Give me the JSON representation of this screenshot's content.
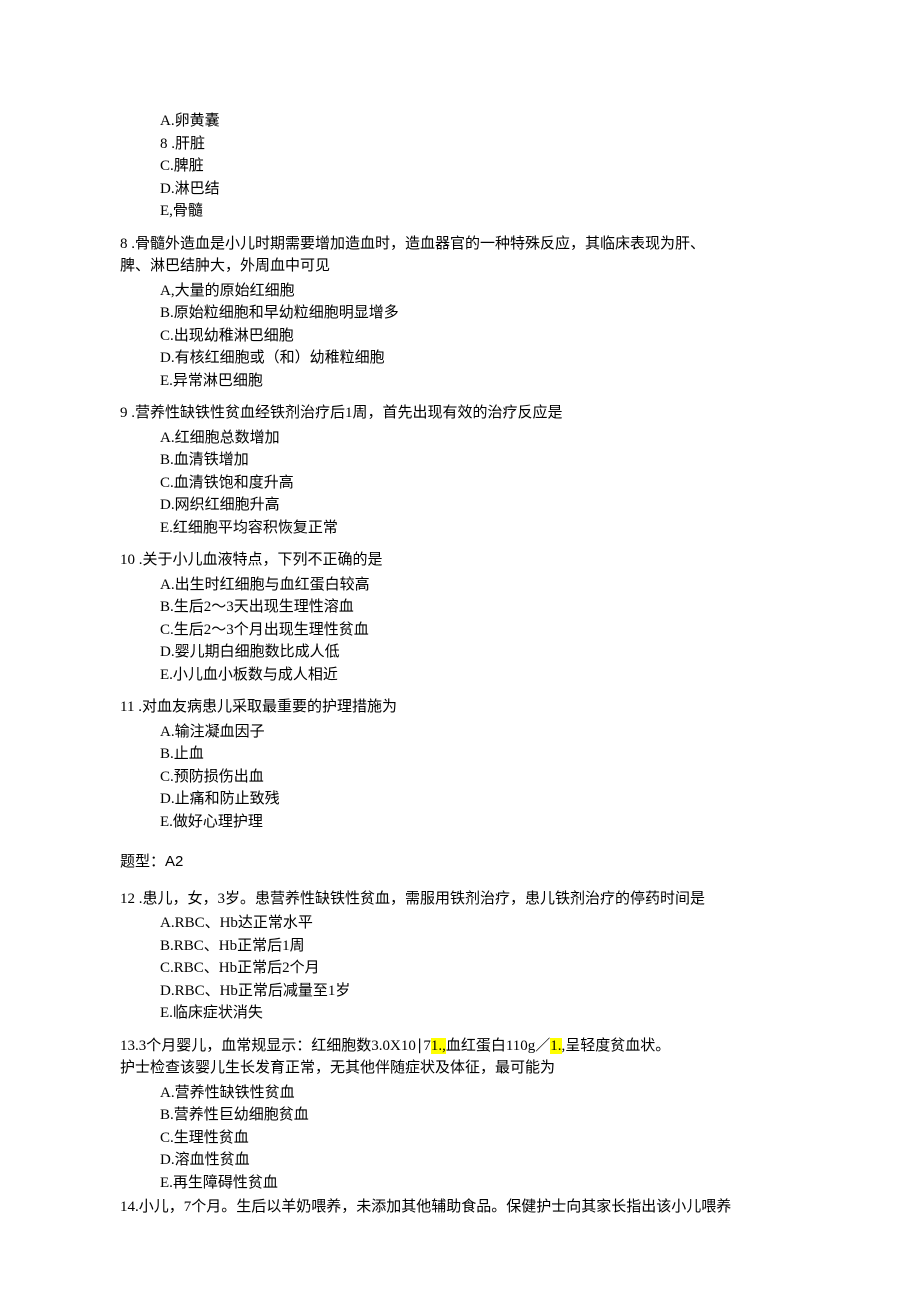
{
  "q7_opts": {
    "A": "A.卵黄囊",
    "B": "8  .肝脏",
    "C": "C.脾脏",
    "D": "D.淋巴结",
    "E": "E,骨髓"
  },
  "q8": {
    "stem1": "8  .骨髓外造血是小儿时期需要增加造血时，造血器官的一种特殊反应，其临床表现为肝、",
    "stem2": "脾、淋巴结肿大，外周血中可见",
    "A": "A,大量的原始红细胞",
    "B": "B.原始粒细胞和早幼粒细胞明显增多",
    "C": "C.出现幼稚淋巴细胞",
    "D": "D.有核红细胞或（和）幼稚粒细胞",
    "E": "E.异常淋巴细胞"
  },
  "q9": {
    "stem": "9  .营养性缺铁性贫血经铁剂治疗后1周，首先出现有效的治疗反应是",
    "A": "A.红细胞总数增加",
    "B": "B.血清铁增加",
    "C": "C.血清铁饱和度升高",
    "D": "D.网织红细胞升高",
    "E": "E.红细胞平均容积恢复正常"
  },
  "q10": {
    "stem": "10  .关于小儿血液特点，下列不正确的是",
    "A": "A.出生时红细胞与血红蛋白较高",
    "B": "B.生后2～3天出现生理性溶血",
    "C": "C.生后2～3个月出现生理性贫血",
    "D": "D.婴儿期白细胞数比成人低",
    "E": "E.小儿血小板数与成人相近"
  },
  "q11": {
    "stem": "11  .对血友病患儿采取最重要的护理措施为",
    "A": "A.输注凝血因子",
    "B": "B.止血",
    "C": "C.预防损伤出血",
    "D": "D.止痛和防止致残",
    "E": "E.做好心理护理"
  },
  "section_a2": "题型：A2",
  "q12": {
    "stem": "12  .患儿，女，3岁。患营养性缺铁性贫血，需服用铁剂治疗，患儿铁剂治疗的停药时间是",
    "A": "A.RBC、Hb达正常水平",
    "B": "B.RBC、Hb正常后1周",
    "C": "C.RBC、Hb正常后2个月",
    "D": "D.RBC、Hb正常后减量至1岁",
    "E": "E.临床症状消失"
  },
  "q13": {
    "stem1_a": "13.3个月婴儿，血常规显示：红细胞数3.0X10∣7",
    "stem1_hl1": "1.,",
    "stem1_b": "血红蛋白110g／",
    "stem1_hl2": "1.",
    "stem1_c": ",呈轻度贫血状。",
    "stem2": "护士检查该婴儿生长发育正常，无其他伴随症状及体征，最可能为",
    "A": "A.营养性缺铁性贫血",
    "B": "B.营养性巨幼细胞贫血",
    "C": "C.生理性贫血",
    "D": "D.溶血性贫血",
    "E": "E.再生障碍性贫血"
  },
  "q14": {
    "stem": "14.小儿，7个月。生后以羊奶喂养，未添加其他辅助食品。保健护士向其家长指出该小儿喂养"
  }
}
